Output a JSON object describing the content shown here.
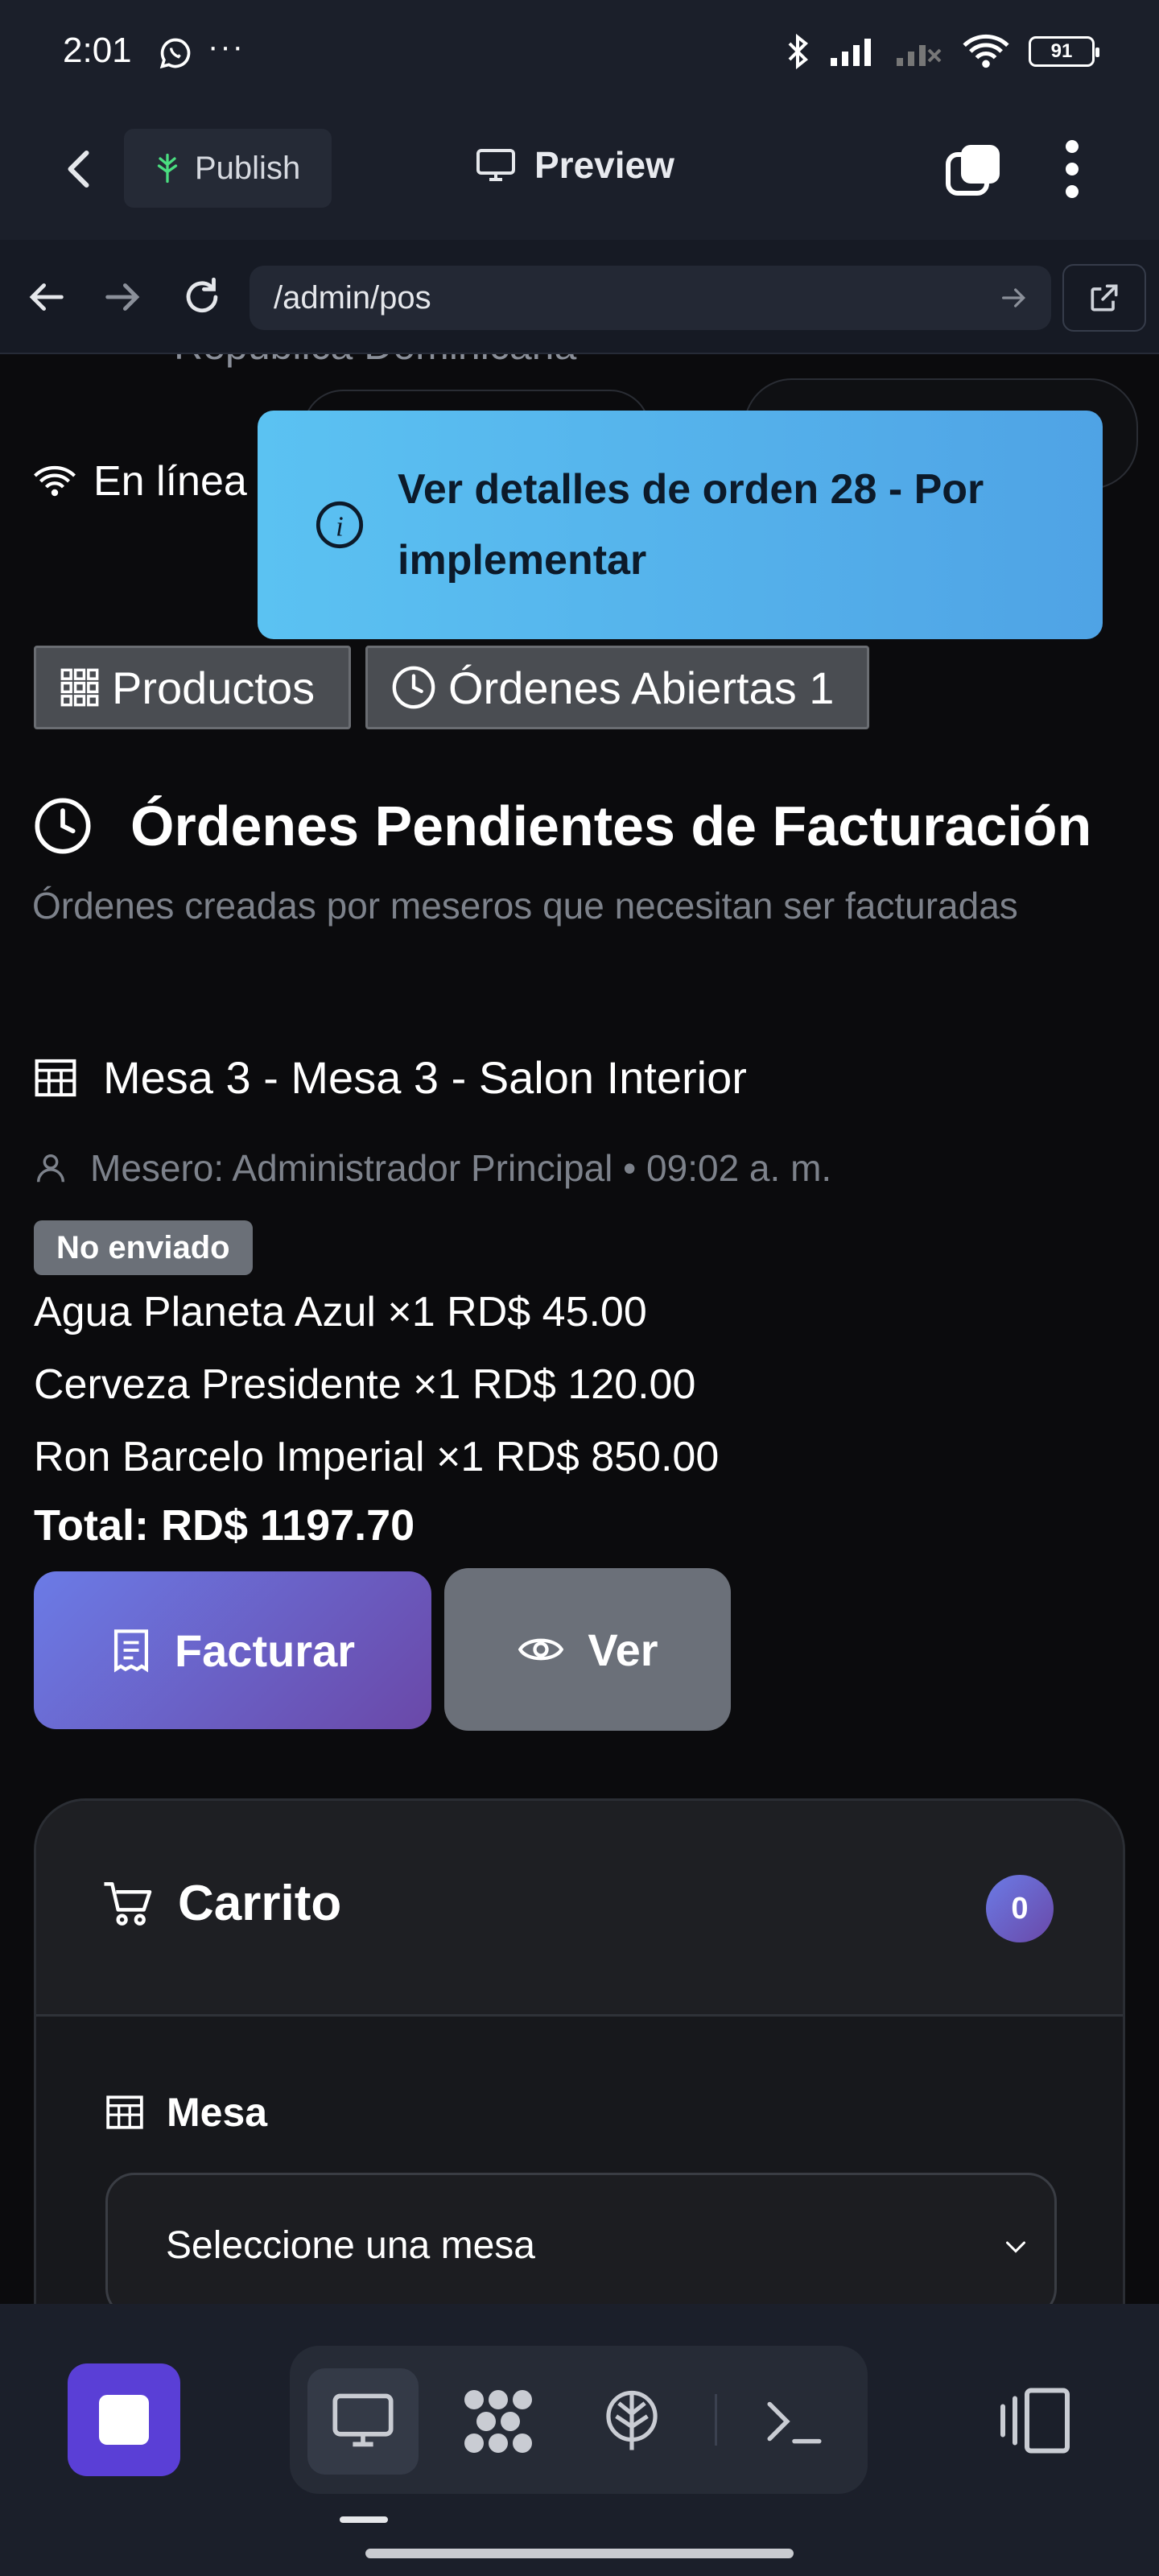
{
  "status_bar": {
    "time": "2:01",
    "overflow": "···",
    "battery": "91"
  },
  "app_bar": {
    "publish_label": "Publish",
    "preview_label": "Preview"
  },
  "browser": {
    "url": "/admin/pos"
  },
  "header": {
    "country": "República Dominicana",
    "status": "En línea"
  },
  "toast": {
    "message": "Ver detalles de orden 28 - Por implementar"
  },
  "tabs": [
    {
      "label": "Productos"
    },
    {
      "label": "Órdenes Abiertas 1"
    }
  ],
  "section": {
    "title": "Órdenes Pendientes de Facturación",
    "subtitle": "Órdenes creadas por meseros que necesitan ser facturadas"
  },
  "order": {
    "title": "Mesa 3 - Mesa 3 - Salon Interior",
    "waiter_line": "Mesero: Administrador Principal • 09:02 a. m.",
    "badge": "No enviado",
    "items": [
      {
        "text": "Agua Planeta Azul ×1 RD$ 45.00"
      },
      {
        "text": "Cerveza Presidente ×1 RD$ 120.00"
      },
      {
        "text": "Ron Barcelo Imperial ×1 RD$ 850.00"
      }
    ],
    "total": "Total: RD$ 1197.70",
    "invoice_label": "Facturar",
    "view_label": "Ver"
  },
  "cart": {
    "title": "Carrito",
    "count": "0",
    "table_label": "Mesa",
    "table_select": "Seleccione una mesa"
  },
  "colors": {
    "accent": "#5a3fd6",
    "toast": "#4fa3e5",
    "badge": "#6b7078"
  }
}
